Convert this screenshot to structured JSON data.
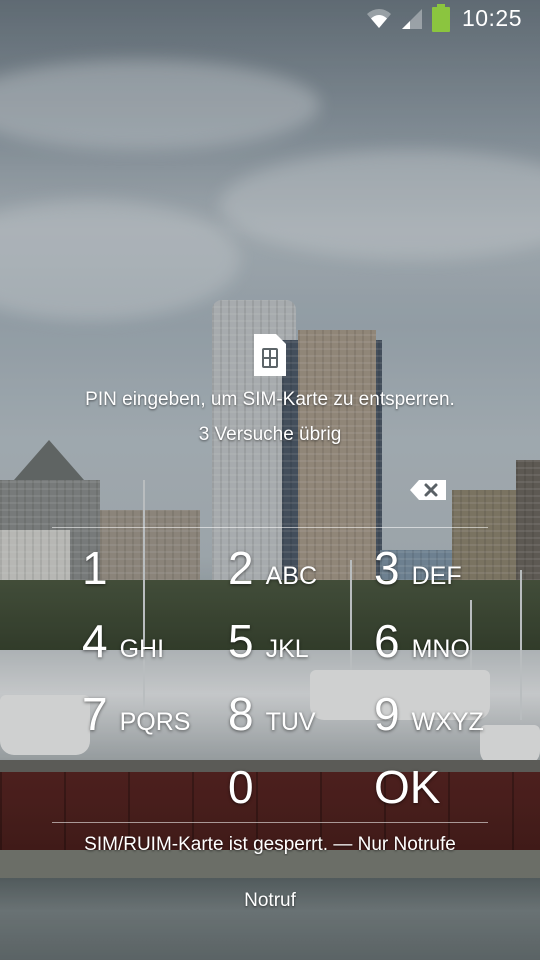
{
  "status_bar": {
    "time": "10:25",
    "icons": [
      "wifi-icon",
      "signal-icon",
      "battery-icon"
    ],
    "battery_color": "#8bc53f"
  },
  "sim_unlock": {
    "icon": "sim-card-icon",
    "prompt": "PIN eingeben, um SIM-Karte zu entsperren.",
    "attempts": "3 Versuche übrig",
    "delete_icon": "backspace-icon"
  },
  "keypad": {
    "keys": [
      {
        "digit": "1",
        "letters": ""
      },
      {
        "digit": "2",
        "letters": "ABC"
      },
      {
        "digit": "3",
        "letters": "DEF"
      },
      {
        "digit": "4",
        "letters": "GHI"
      },
      {
        "digit": "5",
        "letters": "JKL"
      },
      {
        "digit": "6",
        "letters": "MNO"
      },
      {
        "digit": "7",
        "letters": "PQRS"
      },
      {
        "digit": "8",
        "letters": "TUV"
      },
      {
        "digit": "9",
        "letters": "WXYZ"
      },
      {
        "digit": "0",
        "letters": ""
      }
    ],
    "ok_label": "OK"
  },
  "footer": {
    "carrier_status": "SIM/RUIM-Karte ist gesperrt. — Nur Notrufe",
    "emergency_label": "Notruf"
  }
}
